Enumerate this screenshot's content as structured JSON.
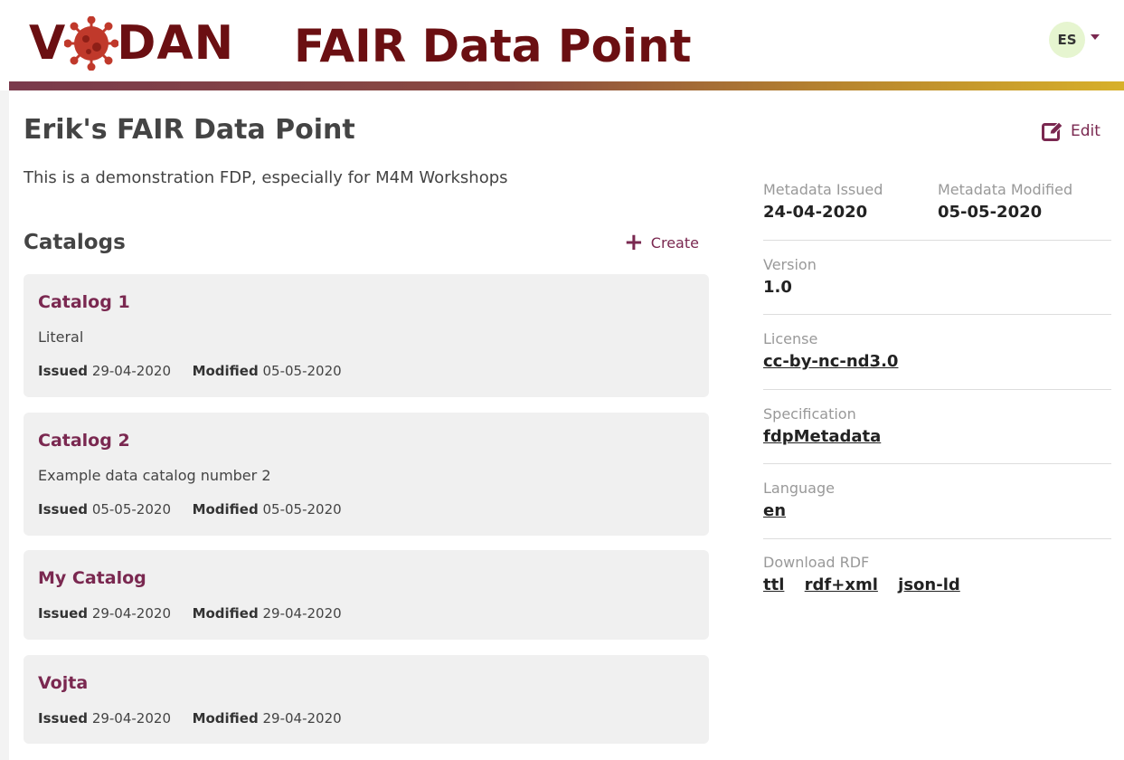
{
  "header": {
    "logo_text_start": "V",
    "logo_text_end": "DAN",
    "app_title": "FAIR Data Point",
    "user_initials": "ES"
  },
  "fdp": {
    "title": "Erik's FAIR Data Point",
    "description": "This is a demonstration FDP, especially for M4M Workshops",
    "edit_label": "Edit"
  },
  "catalogs": {
    "heading": "Catalogs",
    "create_label": "Create",
    "issued_label": "Issued",
    "modified_label": "Modified",
    "items": [
      {
        "title": "Catalog 1",
        "description": "Literal",
        "issued": "29-04-2020",
        "modified": "05-05-2020"
      },
      {
        "title": "Catalog 2",
        "description": "Example data catalog number 2",
        "issued": "05-05-2020",
        "modified": "05-05-2020"
      },
      {
        "title": "My Catalog",
        "issued": "29-04-2020",
        "modified": "29-04-2020"
      },
      {
        "title": "Vojta",
        "issued": "29-04-2020",
        "modified": "29-04-2020"
      }
    ]
  },
  "metadata": {
    "issued_label": "Metadata Issued",
    "issued_value": "24-04-2020",
    "modified_label": "Metadata Modified",
    "modified_value": "05-05-2020",
    "version_label": "Version",
    "version_value": "1.0",
    "license_label": "License",
    "license_value": "cc-by-nc-nd3.0",
    "specification_label": "Specification",
    "specification_value": "fdpMetadata",
    "language_label": "Language",
    "language_value": "en",
    "download_label": "Download RDF",
    "download_formats": [
      "ttl",
      "rdf+xml",
      "json-ld"
    ]
  },
  "colors": {
    "brand_dark_red": "#6b0f12",
    "accent_purple": "#7a2850",
    "card_background": "#f0f0f0",
    "avatar_background": "#e6f5d0"
  }
}
